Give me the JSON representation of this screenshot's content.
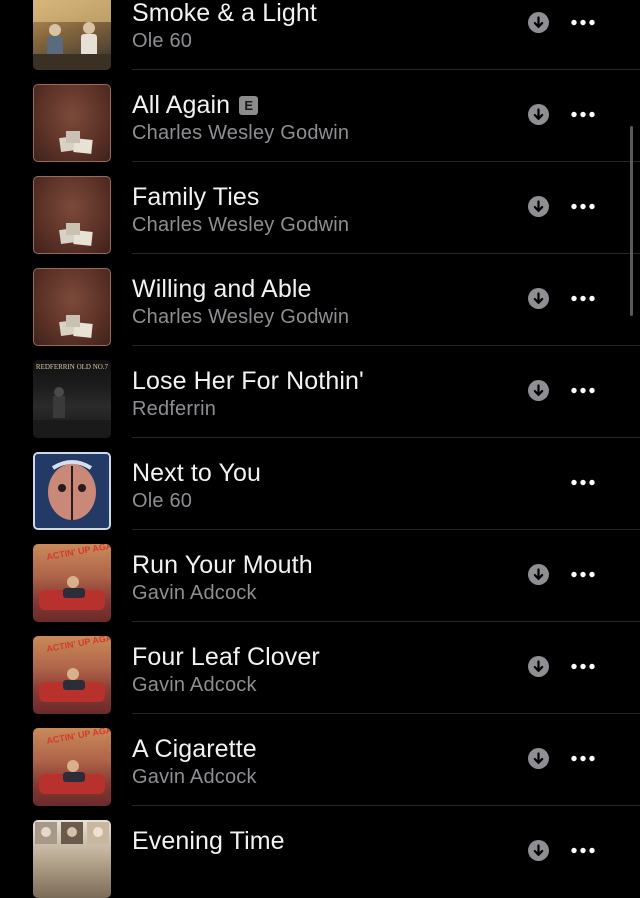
{
  "colors": {
    "background": "#000000",
    "title": "#f2f2f2",
    "artist": "#8e8e93",
    "icon": "#8e8e93",
    "separator": "#262628"
  },
  "songs": [
    {
      "title": "Smoke & a Light",
      "artist": "Ole 60",
      "explicit": false,
      "downloaded": true,
      "art": "ole-60-album-art"
    },
    {
      "title": "All Again",
      "artist": "Charles Wesley Godwin",
      "explicit": true,
      "explicit_label": "E",
      "downloaded": true,
      "art": "charles-wesley-godwin-album-art"
    },
    {
      "title": "Family Ties",
      "artist": "Charles Wesley Godwin",
      "explicit": false,
      "downloaded": true,
      "art": "charles-wesley-godwin-album-art"
    },
    {
      "title": "Willing and Able",
      "artist": "Charles Wesley Godwin",
      "explicit": false,
      "downloaded": true,
      "art": "charles-wesley-godwin-album-art"
    },
    {
      "title": "Lose Her For Nothin'",
      "artist": "Redferrin",
      "explicit": false,
      "downloaded": true,
      "art": "redferrin-album-art",
      "art_text": "REDFERRIN  OLD NO.7"
    },
    {
      "title": "Next to You",
      "artist": "Ole 60",
      "explicit": false,
      "downloaded": false,
      "art": "ole-60-next-to-you-art"
    },
    {
      "title": "Run Your Mouth",
      "artist": "Gavin Adcock",
      "explicit": false,
      "downloaded": true,
      "art": "gavin-adcock-album-art",
      "art_text": "ACTIN' UP AGAIN"
    },
    {
      "title": "Four Leaf Clover",
      "artist": "Gavin Adcock",
      "explicit": false,
      "downloaded": true,
      "art": "gavin-adcock-album-art",
      "art_text": "ACTIN' UP AGAIN"
    },
    {
      "title": "A Cigarette",
      "artist": "Gavin Adcock",
      "explicit": false,
      "downloaded": true,
      "art": "gavin-adcock-album-art",
      "art_text": "ACTIN' UP AGAIN"
    },
    {
      "title": "Evening Time",
      "artist": "",
      "explicit": false,
      "downloaded": true,
      "art": "evening-time-album-art"
    }
  ]
}
